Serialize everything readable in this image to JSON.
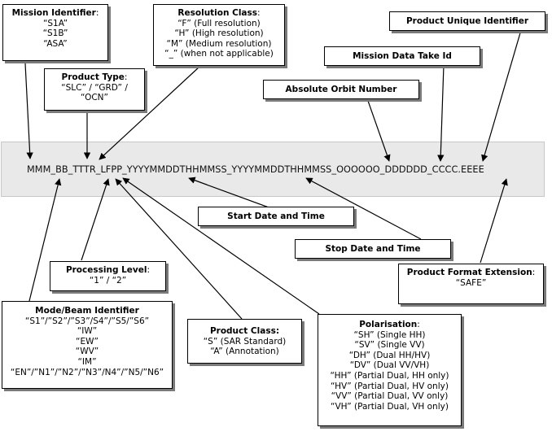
{
  "filename_template": "MMM_BB_TTTR_LFPP_YYYYMMDDTHHMMSS_YYYYMMDDTHHMMSS_OOOOOO_DDDDDD_CCCC.EEEE",
  "boxes": {
    "mission_identifier": {
      "title": "Mission Identifier",
      "colon": ":",
      "values": [
        "“S1A”",
        "“S1B”",
        "“ASA”"
      ]
    },
    "product_type": {
      "title": "Product Type",
      "colon": ":",
      "values": [
        "“SLC” / “GRD” /",
        "“OCN”"
      ]
    },
    "resolution_class": {
      "title": "Resolution Class",
      "colon": ":",
      "values": [
        "“F” (Full resolution)",
        "“H” (High resolution)",
        "“M” (Medium resolution)",
        "“_” (when not applicable)"
      ]
    },
    "product_unique_identifier": {
      "title": "Product Unique Identifier"
    },
    "mission_data_take_id": {
      "title": "Mission Data Take Id"
    },
    "absolute_orbit_number": {
      "title": "Absolute Orbit Number"
    },
    "start_date_time": {
      "title": "Start Date and Time"
    },
    "stop_date_time": {
      "title": "Stop Date and Time"
    },
    "processing_level": {
      "title": "Processing Level",
      "colon": ":",
      "values": [
        "“1” / “2”"
      ]
    },
    "product_format_extension": {
      "title": "Product Format Extension",
      "colon": ":",
      "values": [
        "“SAFE”"
      ]
    },
    "mode_beam_identifier": {
      "title": "Mode/Beam Identifier",
      "values": [
        "“S1”/”S2”/”S3”/S4”/”S5/”S6”",
        "“IW”",
        "“EW”",
        "“WV”",
        "“IM”",
        "“EN”/”N1”/”N2”/”N3”/N4”/”N5/”N6”"
      ]
    },
    "product_class": {
      "title": "Product Class:",
      "values": [
        "“S” (SAR Standard)",
        "“A” (Annotation)"
      ]
    },
    "polarisation": {
      "title": "Polarisation",
      "colon": ":",
      "values": [
        "“SH” (Single HH)",
        "“SV” (Single VV)",
        "“DH” (Dual HH/HV)",
        "“DV” (Dual VV/VH)",
        "“HH” (Partial Dual, HH only)",
        "“HV” (Partial Dual, HV only)",
        "“VV” (Partial Dual, VV only)",
        "“VH” (Partial Dual, VH only)"
      ]
    }
  }
}
